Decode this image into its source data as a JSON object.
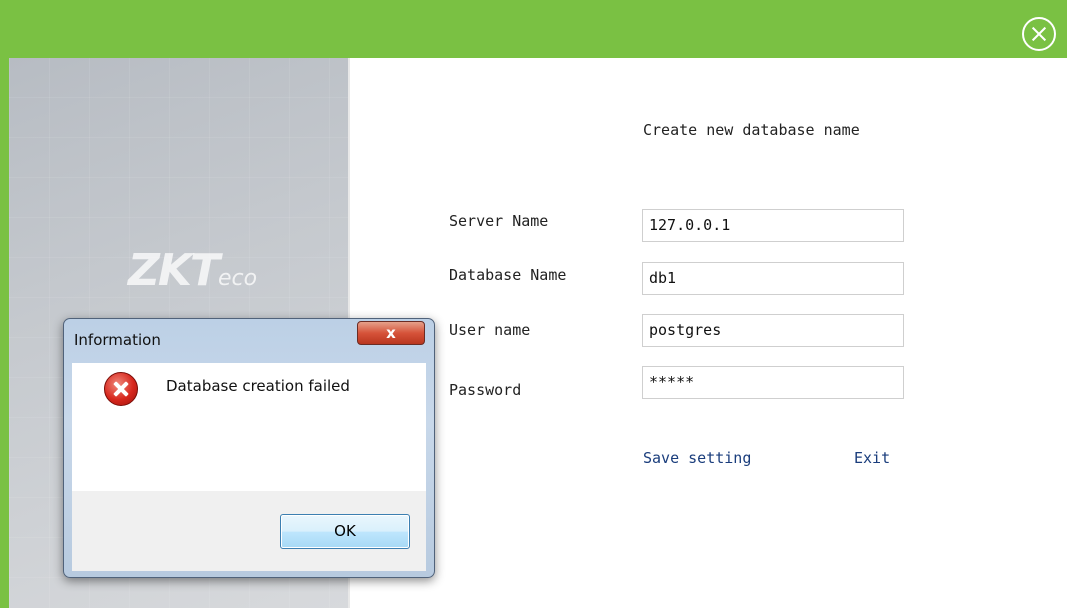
{
  "window": {
    "close_icon": "close-circle-icon",
    "accent_color": "#7ac143"
  },
  "banner": {
    "logo_main": "ZKT",
    "logo_sub": "eco"
  },
  "form": {
    "heading": "Create new database name",
    "server_label": "Server Name",
    "server_value": "127.0.0.1",
    "database_label": "Database Name",
    "database_value": "db1",
    "user_label": "User name",
    "user_value": "postgres",
    "password_label": "Password",
    "password_value": "*****",
    "save_label": "Save setting",
    "exit_label": "Exit"
  },
  "dialog": {
    "title": "Information",
    "close_label": "x",
    "icon": "error-icon",
    "message": "Database creation failed",
    "ok_label": "OK"
  }
}
